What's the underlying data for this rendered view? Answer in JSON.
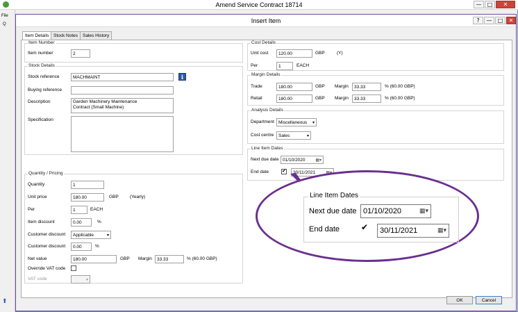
{
  "outer_window": {
    "title": "Amend Service Contract 18714",
    "menu_file_fragment": "File",
    "left_tab_fragment": "Q",
    "min_glyph": "—",
    "max_glyph": "□",
    "close_glyph": "✕",
    "left_arrow_glyph": "⬆"
  },
  "dialog": {
    "title": "Insert Item",
    "help_glyph": "?",
    "min_glyph": "—",
    "max_glyph": "□",
    "close_glyph": "✕"
  },
  "tabs": [
    {
      "label": "Item Details",
      "active": true
    },
    {
      "label": "Stock Notes",
      "active": false
    },
    {
      "label": "Sales History",
      "active": false
    }
  ],
  "item_number_group": {
    "title": "Item Number",
    "item_number_label": "Item number",
    "item_number_value": "2"
  },
  "stock_details": {
    "title": "Stock Details",
    "stock_reference_label": "Stock reference",
    "stock_reference_value": "MACHMAINT",
    "info_glyph": "i",
    "buying_reference_label": "Buying reference",
    "buying_reference_value": "",
    "description_label": "Description",
    "description_line1": "Garden Machinery Maintenance",
    "description_line2": "Contract (Small Machine)",
    "specification_label": "Specification",
    "specification_value": ""
  },
  "quantity_pricing": {
    "title": "Quantity / Pricing",
    "quantity_label": "Quantity",
    "quantity_value": "1",
    "unit_price_label": "Unit price",
    "unit_price_value": "180.00",
    "unit_price_currency": "GBP",
    "unit_price_period": "(Yearly)",
    "per_label": "Per",
    "per_value": "1",
    "per_unit": "EACH",
    "item_discount_label": "Item discount",
    "item_discount_value": "0.00",
    "item_discount_unit": "%",
    "customer_discount_label": "Customer discount",
    "customer_discount_value": "Applicable",
    "customer_discount_pct_label": "Customer discount",
    "customer_discount_pct_value": "0.00",
    "customer_discount_pct_unit": "%",
    "net_value_label": "Net value",
    "net_value_value": "180.00",
    "net_value_currency": "GBP",
    "margin_label": "Margin",
    "margin_value": "33.33",
    "margin_suffix": "%  (60.00 GBP)",
    "override_vat_label": "Override VAT code",
    "vat_code_label": "VAT code",
    "vat_code_value": ""
  },
  "cost_details": {
    "title": "Cost Details",
    "unit_cost_label": "Unit cost",
    "unit_cost_value": "120.00",
    "unit_cost_currency": "GBP",
    "unit_cost_flag": "(Y)",
    "per_label": "Per",
    "per_value": "1",
    "per_unit": "EACH"
  },
  "margin_details": {
    "title": "Margin Details",
    "trade_label": "Trade",
    "trade_value": "180.00",
    "trade_currency": "GBP",
    "trade_margin_label": "Margin",
    "trade_margin_value": "33.33",
    "trade_margin_suffix": "%  (60.00 GBP)",
    "retail_label": "Retail",
    "retail_value": "180.00",
    "retail_currency": "GBP",
    "retail_margin_label": "Margin",
    "retail_margin_value": "33.33",
    "retail_margin_suffix": "%  (60.00 GBP)"
  },
  "analysis_details": {
    "title": "Analysis Details",
    "department_label": "Department",
    "department_value": "Miscellaneous",
    "cost_centre_label": "Cost centre",
    "cost_centre_value": "Sales"
  },
  "line_item_dates": {
    "title": "Line Item Dates",
    "next_due_date_label": "Next due date",
    "next_due_date_value": "01/10/2020",
    "end_date_label": "End date",
    "end_date_checked": "✔",
    "end_date_value": "30/11/2021",
    "calendar_glyph": "▦▾"
  },
  "buttons": {
    "ok_label": "OK",
    "cancel_label": "Cancel"
  },
  "colors": {
    "callout_border": "#6a2f91",
    "window_border": "#6a8fb5",
    "close_button": "#c9453a",
    "info_icon": "#2f5aa8"
  }
}
